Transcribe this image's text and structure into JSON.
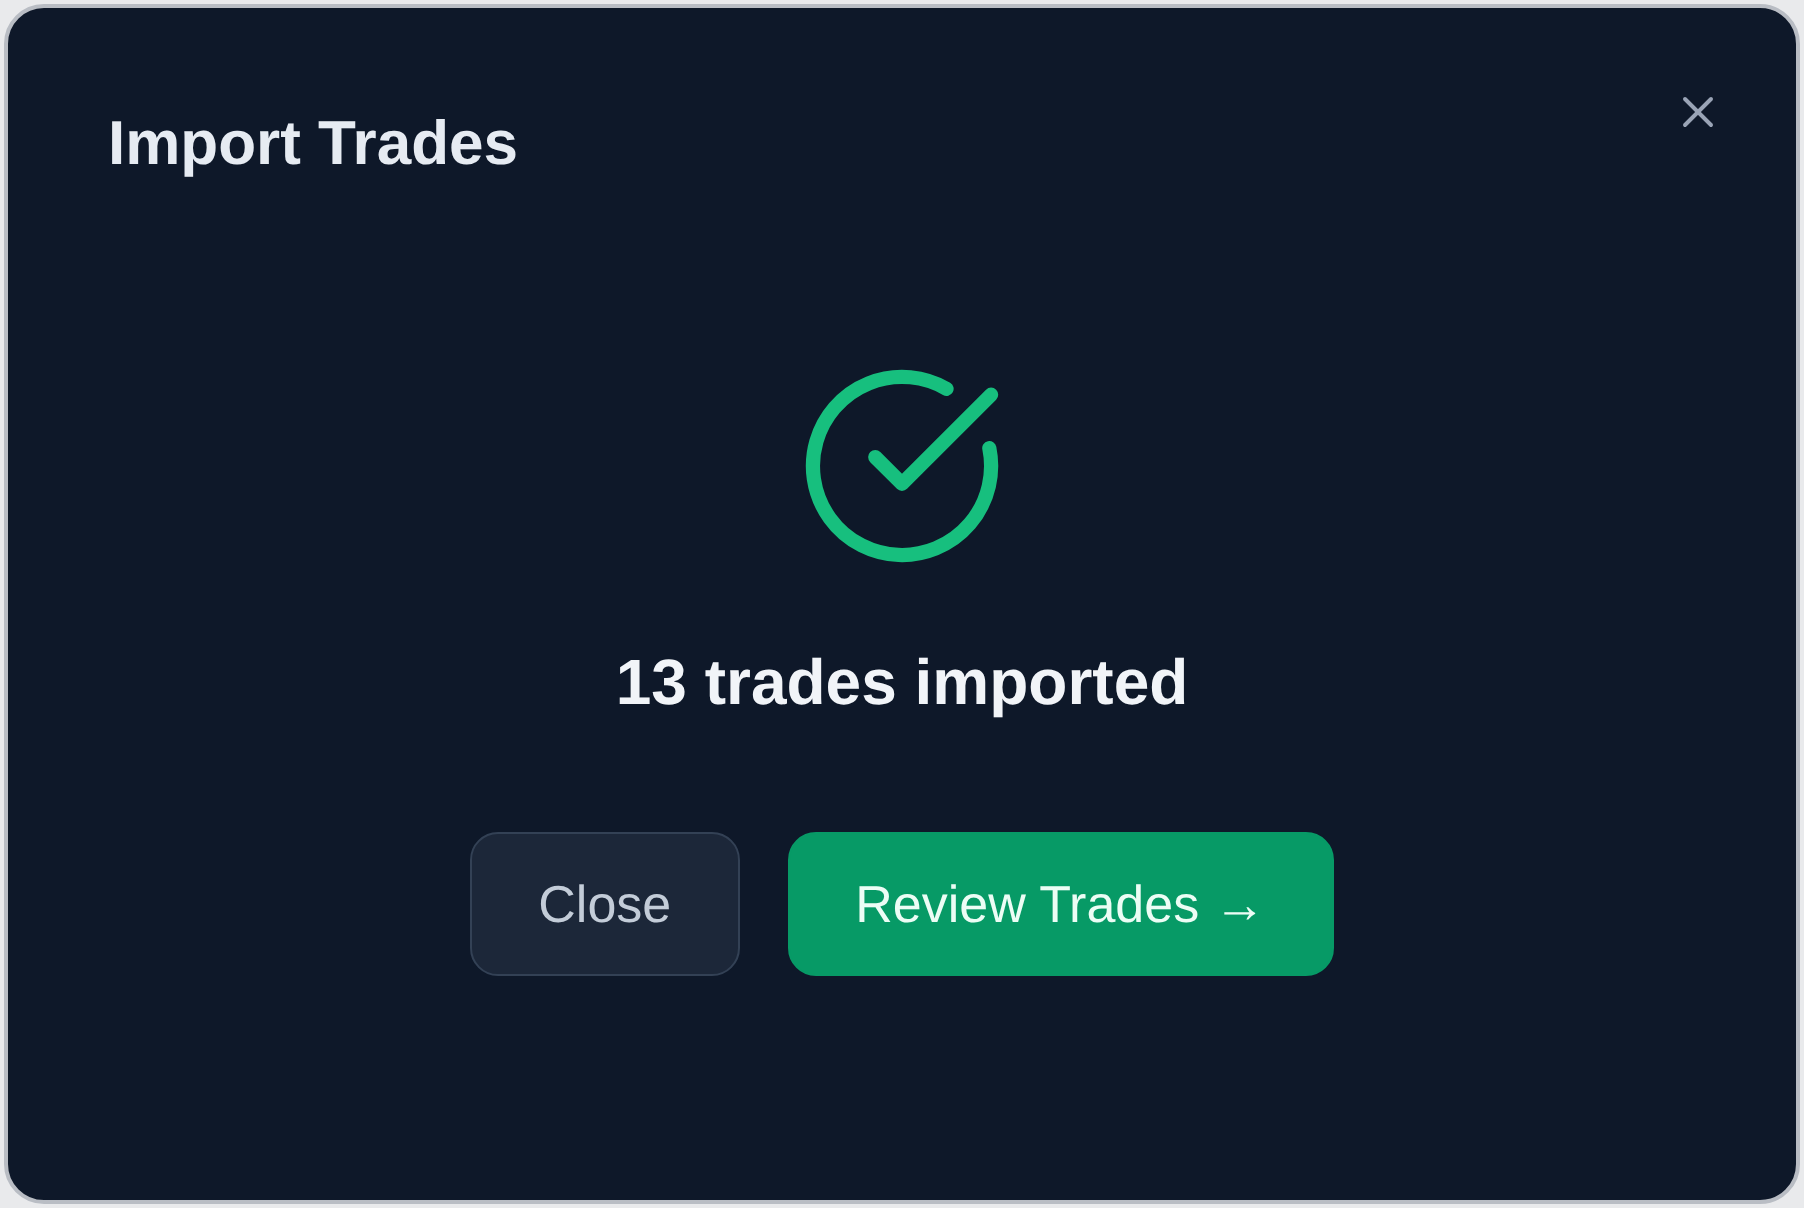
{
  "dialog": {
    "title": "Import Trades",
    "status": {
      "kind": "success",
      "message": "13 trades imported"
    },
    "buttons": [
      {
        "label": "Close",
        "kind": "secondary"
      },
      {
        "label": "Review Trades →",
        "kind": "primary"
      }
    ]
  }
}
